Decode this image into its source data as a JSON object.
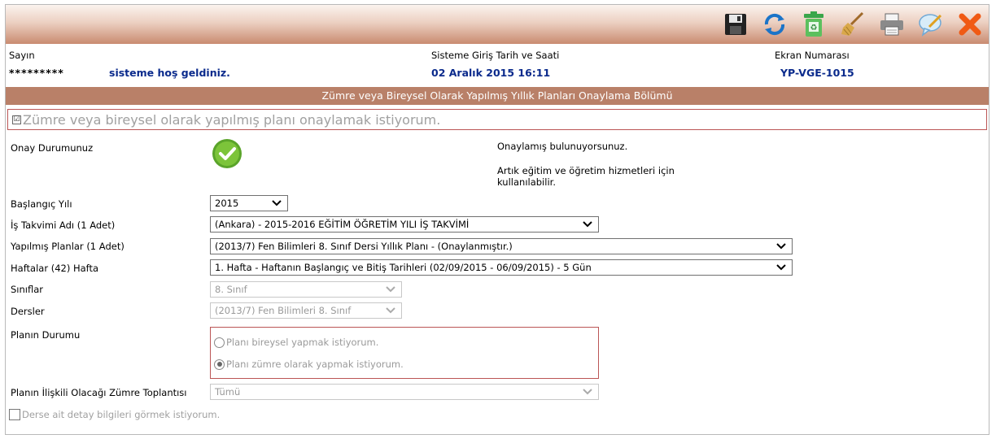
{
  "header": {
    "greeting_label": "Sayın",
    "user_masked": "*********",
    "welcome_text": "sisteme hoş geldiniz.",
    "login_label": "Sisteme Giriş Tarih ve Saati",
    "login_value": "02 Aralık 2015 16:11",
    "screen_label": "Ekran Numarası",
    "screen_value": "YP-VGE-1015"
  },
  "toolbar": {
    "icons": [
      "save-icon",
      "refresh-icon",
      "recycle-bin-icon",
      "broom-icon",
      "printer-icon",
      "comment-icon",
      "close-icon"
    ]
  },
  "section": {
    "title": "Zümre veya Bireysel Olarak Yapılmış Yıllık Planları Onaylama Bölümü"
  },
  "confirm": {
    "label": "Zümre veya bireysel olarak yapılmış planı onaylamak istiyorum.",
    "checked": true
  },
  "status": {
    "label": "Onay Durumunuz",
    "message1": "Onaylamış bulunuyorsunuz.",
    "message2_line1": "Artık eğitim ve öğretim hizmetleri için",
    "message2_line2": "kullanılabilir."
  },
  "form": {
    "start_year_label": "Başlangıç Yılı",
    "start_year_value": "2015",
    "calendar_label": "İş Takvimi Adı (1 Adet)",
    "calendar_value": "(Ankara) - 2015-2016 EĞİTİM ÖĞRETİM YILI İŞ TAKVİMİ",
    "plans_label": "Yapılmış Planlar (1 Adet)",
    "plans_value": "(2013/7) Fen Bilimleri 8. Sınıf Dersi Yıllık Planı - (Onaylanmıştır.)",
    "weeks_label": "Haftalar (42) Hafta",
    "weeks_value": "1. Hafta - Haftanın Başlangıç ve Bitiş Tarihleri (02/09/2015 - 06/09/2015) - 5 Gün",
    "classes_label": "Sınıflar",
    "classes_value": "8. Sınıf",
    "lessons_label": "Dersler",
    "lessons_value": "(2013/7) Fen Bilimleri 8. Sınıf",
    "plan_status_label": "Planın Durumu",
    "radio_individual": "Planı bireysel yapmak istiyorum.",
    "radio_group": "Planı zümre olarak yapmak istiyorum.",
    "radio_selected": "group",
    "meeting_label": "Planın İlişkili Olacağı Zümre Toplantısı",
    "meeting_value": "Tümü",
    "detail_label": "Derse ait detay bilgileri görmek istiyorum."
  },
  "colors": {
    "section_bar": "#b98068",
    "header_blue": "#0a2a8c",
    "border_red": "#bb5555"
  }
}
